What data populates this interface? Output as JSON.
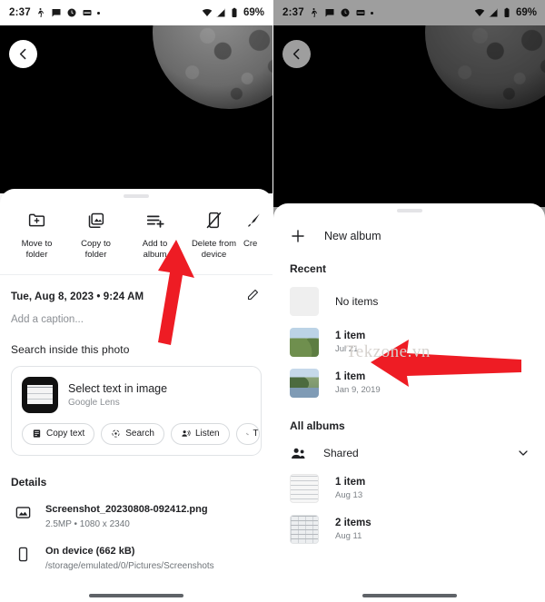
{
  "statusbar": {
    "time": "2:37",
    "battery_percent": "69%",
    "icons": [
      "hiking-icon",
      "message-icon",
      "clock-icon",
      "wallet-icon",
      "dot-icon"
    ],
    "right_icons": [
      "wifi-icon",
      "signal-icon",
      "battery-icon"
    ]
  },
  "left_panel": {
    "back_label": "Back",
    "actions": [
      {
        "label": "Move to\nfolder",
        "icon": "move-to-folder-icon"
      },
      {
        "label": "Copy to\nfolder",
        "icon": "copy-to-folder-icon"
      },
      {
        "label": "Add to\nalbum",
        "icon": "add-to-album-icon"
      },
      {
        "label": "Delete from\ndevice",
        "icon": "delete-from-device-icon"
      },
      {
        "label": "Cre",
        "icon": "create-brush-icon"
      }
    ],
    "date": "Tue, Aug 8, 2023  •  9:24 AM",
    "edit_icon": "pencil-icon",
    "caption_placeholder": "Add a caption...",
    "lens": {
      "section_title": "Search inside this photo",
      "card_title": "Select text in image",
      "card_subtitle": "Google Lens",
      "chips": [
        {
          "label": "Copy text",
          "icon": "copy-text-icon"
        },
        {
          "label": "Search",
          "icon": "lens-search-icon"
        },
        {
          "label": "Listen",
          "icon": "listen-icon"
        },
        {
          "label": "T",
          "icon": "translate-icon"
        }
      ]
    },
    "details": {
      "title": "Details",
      "rows": [
        {
          "icon": "image-icon",
          "primary": "Screenshot_20230808-092412.png",
          "secondary": "2.5MP  •  1080 x 2340"
        },
        {
          "icon": "phone-icon",
          "primary": "On device (662 kB)",
          "secondary": "/storage/emulated/0/Pictures/Screenshots"
        }
      ]
    }
  },
  "right_panel": {
    "new_album": {
      "label": "New album",
      "icon": "plus-icon"
    },
    "recent": {
      "title": "Recent",
      "items": [
        {
          "primary": "No items",
          "secondary": "",
          "thumb": "empty"
        },
        {
          "primary": "1 item",
          "secondary": "Jul 21",
          "thumb": "hill"
        },
        {
          "primary": "1 item",
          "secondary": "Jan 9, 2019",
          "thumb": "lake"
        }
      ]
    },
    "all_albums": {
      "title": "All albums",
      "shared": {
        "label": "Shared",
        "icon": "people-icon",
        "chevron": "chevron-down-icon"
      },
      "items": [
        {
          "primary": "1 item",
          "secondary": "Aug 13",
          "thumb": "doc"
        },
        {
          "primary": "2 items",
          "secondary": "Aug 11",
          "thumb": "doc2"
        }
      ]
    }
  },
  "annotations": {
    "watermark": "Tekzone.vn",
    "arrow_color": "#ee1c24"
  }
}
